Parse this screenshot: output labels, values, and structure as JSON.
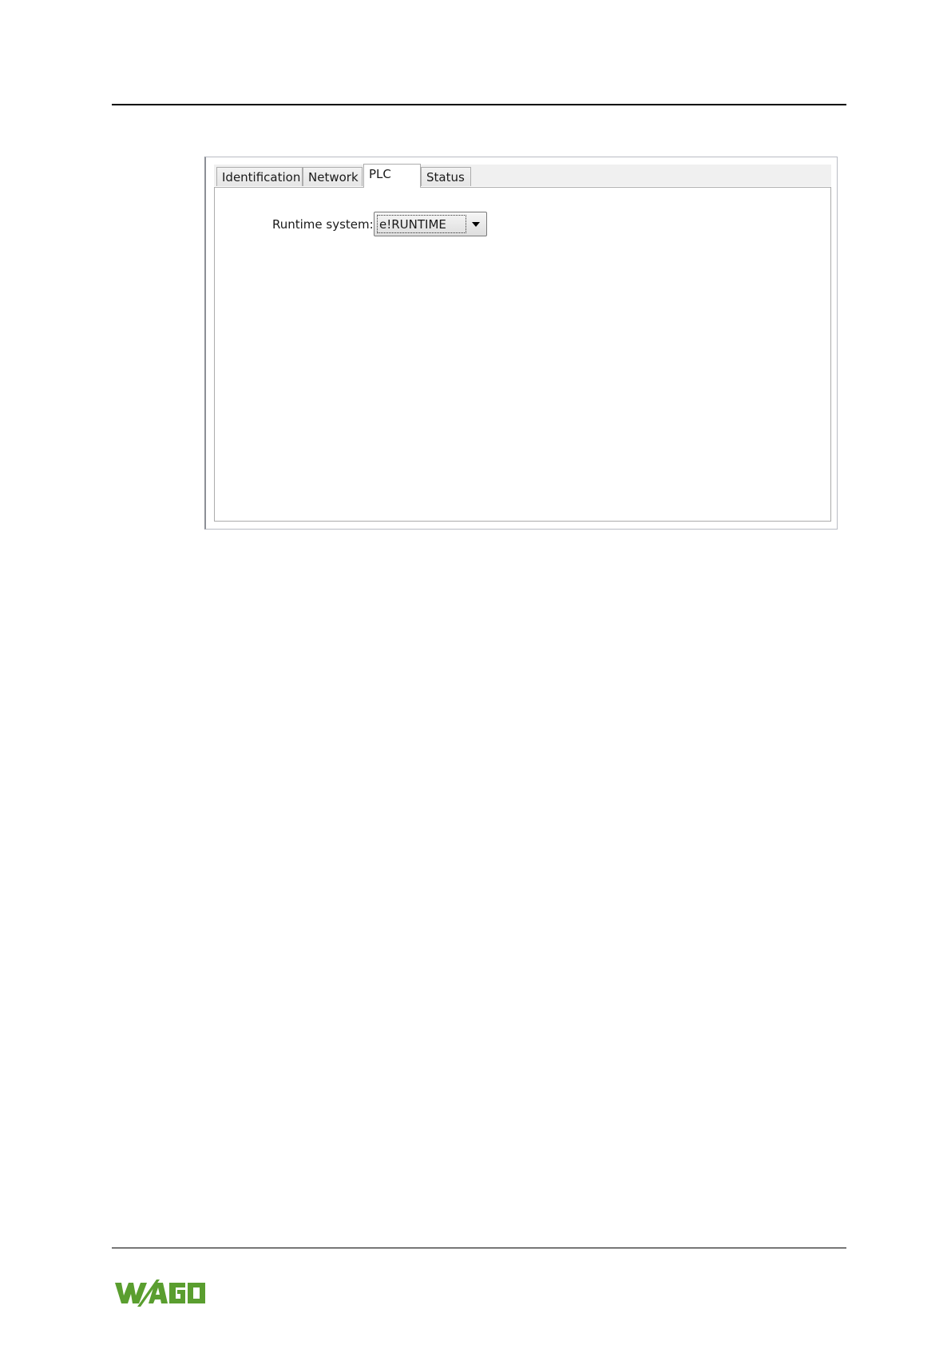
{
  "dialog": {
    "tabs": [
      {
        "label": "Identification",
        "active": false
      },
      {
        "label": "Network",
        "active": false
      },
      {
        "label": "PLC",
        "active": true
      },
      {
        "label": "Status",
        "active": false
      }
    ],
    "runtime_system_label": "Runtime system:",
    "runtime_system_value": "e!RUNTIME"
  },
  "footer": {
    "logo_text": "WAGO",
    "logo_color": "#5a9e2f"
  },
  "colors": {
    "tab_border": "#acacac",
    "tab_strip_bg": "#f0f0f0"
  }
}
